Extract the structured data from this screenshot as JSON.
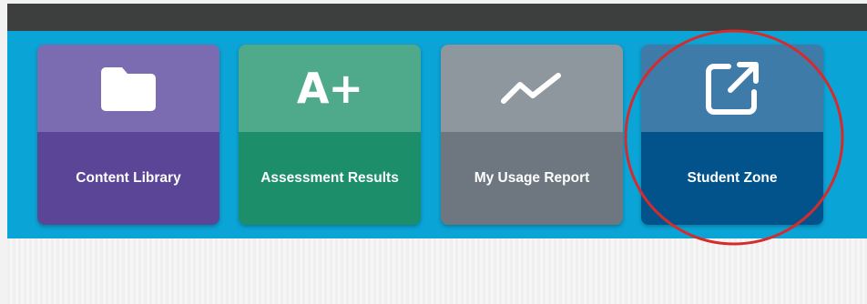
{
  "tiles": [
    {
      "label": "Content Library",
      "icon": "folder-icon"
    },
    {
      "label": "Assessment Results",
      "icon": "grade-a-plus-icon",
      "glyph": "A+"
    },
    {
      "label": "My Usage Report",
      "icon": "line-chart-icon"
    },
    {
      "label": "Student Zone",
      "icon": "external-link-icon"
    }
  ],
  "colors": {
    "band": "#0aa4d6",
    "topbar": "#3d3e3e",
    "content_library": "#5a4597",
    "assessment_results": "#1c8f6a",
    "usage_report": "#6e7780",
    "student_zone": "#02528c",
    "highlight_circle": "#d62b2b"
  }
}
